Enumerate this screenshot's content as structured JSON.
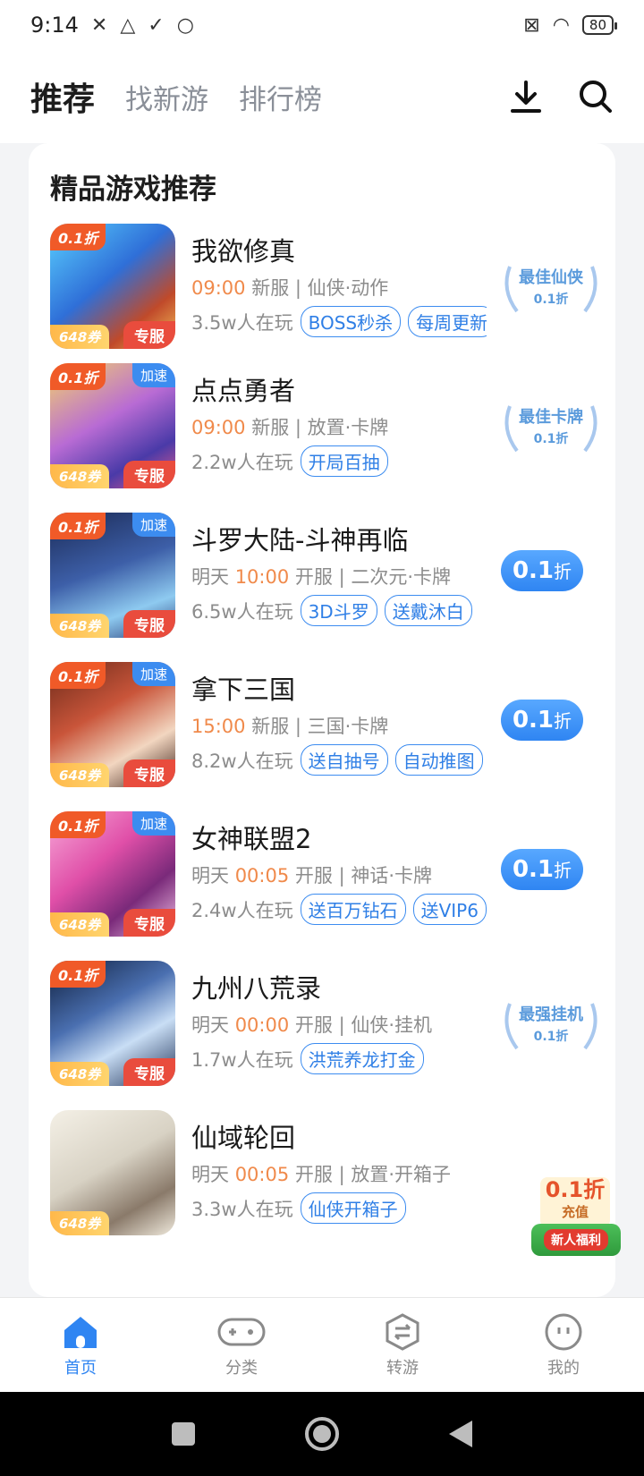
{
  "status_bar": {
    "time": "9:14",
    "battery": "80"
  },
  "top_nav": {
    "tabs": [
      {
        "label": "推荐",
        "active": true
      },
      {
        "label": "找新游",
        "active": false
      },
      {
        "label": "排行榜",
        "active": false
      }
    ]
  },
  "section": {
    "title": "精品游戏推荐"
  },
  "games": [
    {
      "name": "我欲修真",
      "meta_pre": "",
      "time": "09:00",
      "meta_post": " 新服 | 仙侠·动作",
      "players": "3.5w人在玩",
      "tags": [
        "BOSS秒杀",
        "每周更新"
      ],
      "badge_discount": "0.1折",
      "badge_speed": "",
      "badge_coupon": "648券",
      "badge_exclusive": "专服",
      "award": {
        "title": "最佳仙侠",
        "sub": "0.1折"
      },
      "pill": null
    },
    {
      "name": "点点勇者",
      "meta_pre": "",
      "time": "09:00",
      "meta_post": " 新服 | 放置·卡牌",
      "players": "2.2w人在玩",
      "tags": [
        "开局百抽"
      ],
      "badge_discount": "0.1折",
      "badge_speed": "加速",
      "badge_coupon": "648券",
      "badge_exclusive": "专服",
      "award": {
        "title": "最佳卡牌",
        "sub": "0.1折"
      },
      "pill": null
    },
    {
      "name": "斗罗大陆-斗神再临",
      "meta_pre": "明天 ",
      "time": "10:00",
      "meta_post": " 开服 | 二次元·卡牌",
      "players": "6.5w人在玩",
      "tags": [
        "3D斗罗",
        "送戴沐白"
      ],
      "badge_discount": "0.1折",
      "badge_speed": "加速",
      "badge_coupon": "648券",
      "badge_exclusive": "专服",
      "award": null,
      "pill": {
        "value": "0.1",
        "unit": "折"
      }
    },
    {
      "name": "拿下三国",
      "meta_pre": "",
      "time": "15:00",
      "meta_post": " 新服 | 三国·卡牌",
      "players": "8.2w人在玩",
      "tags": [
        "送自抽号",
        "自动推图"
      ],
      "badge_discount": "0.1折",
      "badge_speed": "加速",
      "badge_coupon": "648券",
      "badge_exclusive": "专服",
      "award": null,
      "pill": {
        "value": "0.1",
        "unit": "折"
      }
    },
    {
      "name": "女神联盟2",
      "meta_pre": "明天 ",
      "time": "00:05",
      "meta_post": " 开服 | 神话·卡牌",
      "players": "2.4w人在玩",
      "tags": [
        "送百万钻石",
        "送VIP6"
      ],
      "badge_discount": "0.1折",
      "badge_speed": "加速",
      "badge_coupon": "648券",
      "badge_exclusive": "专服",
      "award": null,
      "pill": {
        "value": "0.1",
        "unit": "折"
      }
    },
    {
      "name": "九州八荒录",
      "meta_pre": "明天 ",
      "time": "00:00",
      "meta_post": " 开服 | 仙侠·挂机",
      "players": "1.7w人在玩",
      "tags": [
        "洪荒养龙打金"
      ],
      "badge_discount": "0.1折",
      "badge_speed": "",
      "badge_coupon": "648券",
      "badge_exclusive": "专服",
      "award": {
        "title": "最强挂机",
        "sub": "0.1折"
      },
      "pill": null
    },
    {
      "name": "仙域轮回",
      "meta_pre": "明天 ",
      "time": "00:05",
      "meta_post": " 开服 | 放置·开箱子",
      "players": "3.3w人在玩",
      "tags": [
        "仙侠开箱子"
      ],
      "badge_discount": "",
      "badge_speed": "",
      "badge_coupon": "648券",
      "badge_exclusive": "",
      "award": null,
      "pill": null
    }
  ],
  "float_promo": {
    "line1": "0.1折",
    "line2": "充值",
    "line3": "新人福利"
  },
  "bottom_tabs": [
    {
      "label": "首页",
      "active": true
    },
    {
      "label": "分类",
      "active": false
    },
    {
      "label": "转游",
      "active": false
    },
    {
      "label": "我的",
      "active": false
    }
  ],
  "colors": {
    "accent": "#2f85f2",
    "highlight": "#f08a4b",
    "tag": "#3c8cf0",
    "exclusive": "#e94c3d"
  }
}
